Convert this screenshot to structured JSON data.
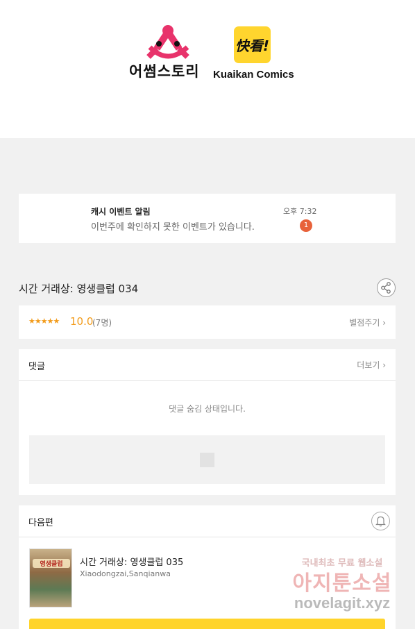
{
  "banner": {
    "awesome_story_text": "어썸스토리",
    "awesome_story_letter": "A",
    "kuaikan_box_text": "快看!",
    "kuaikan_text": "Kuaikan Comics"
  },
  "notification": {
    "title": "캐시 이벤트 알림",
    "body": "이번주에 확인하지 못한 이벤트가 있습니다.",
    "time": "오후 7:32",
    "badge": "1"
  },
  "episode": {
    "title": "시간 거래상: 영생클럽 034"
  },
  "rating": {
    "stars": "★★★★★",
    "value": "10.0",
    "count": "(7명)",
    "rate_label": "별점주기 ›"
  },
  "comments": {
    "title": "댓글",
    "more_label": "더보기 ›",
    "hidden_message": "댓글 숨김 상태입니다."
  },
  "next_episode": {
    "section_title": "다음편",
    "thumb_label": "영생클럽",
    "title": "시간 거래상: 영생클럽 035",
    "author": "Xiaodongzai,Sanqianwa"
  },
  "watermark": {
    "line1": "국내최초 무료 웹소설",
    "line2": "아지툰소설",
    "line3": "novelagit.xyz"
  },
  "colors": {
    "accent_yellow": "#ffd42b",
    "rating_orange": "#f29b1a",
    "badge_red": "#e8623a",
    "logo_pink": "#e8336b"
  }
}
